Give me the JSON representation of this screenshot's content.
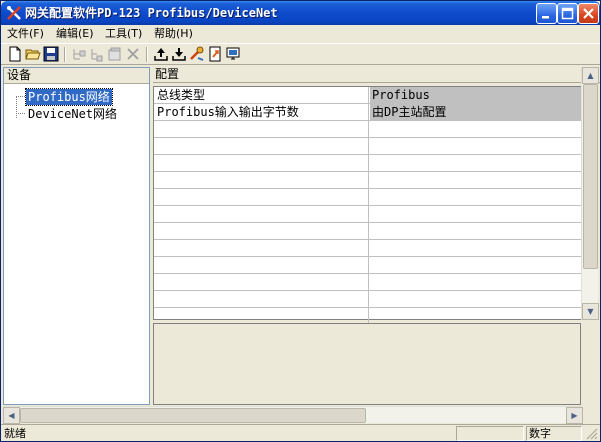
{
  "window": {
    "title": "网关配置软件PD-123 Profibus/DeviceNet"
  },
  "menu": {
    "items": [
      "文件(F)",
      "编辑(E)",
      "工具(T)",
      "帮助(H)"
    ]
  },
  "toolbar": {
    "icons": [
      "new-file-icon",
      "open-folder-icon",
      "save-icon",
      "insert-node-icon",
      "insert-child-icon",
      "properties-icon",
      "delete-icon",
      "upload-icon",
      "download-icon",
      "tools-icon",
      "export-icon",
      "monitor-icon"
    ]
  },
  "device_panel": {
    "header": "设备",
    "tree": [
      {
        "label": "Profibus网络",
        "selected": true
      },
      {
        "label": "DeviceNet网络",
        "selected": false
      }
    ]
  },
  "config_panel": {
    "header": "配置",
    "rows": [
      {
        "name": "总线类型",
        "value": "Profibus"
      },
      {
        "name": "Profibus输入输出字节数",
        "value": "由DP主站配置"
      }
    ],
    "empty_rows": 12
  },
  "statusbar": {
    "status": "就绪",
    "indicator": "数字"
  },
  "colors": {
    "title_bar": "#0a45c2",
    "selection": "#316ac5",
    "shaded_value": "#c0c0c0",
    "window_bg": "#ece9d8"
  }
}
